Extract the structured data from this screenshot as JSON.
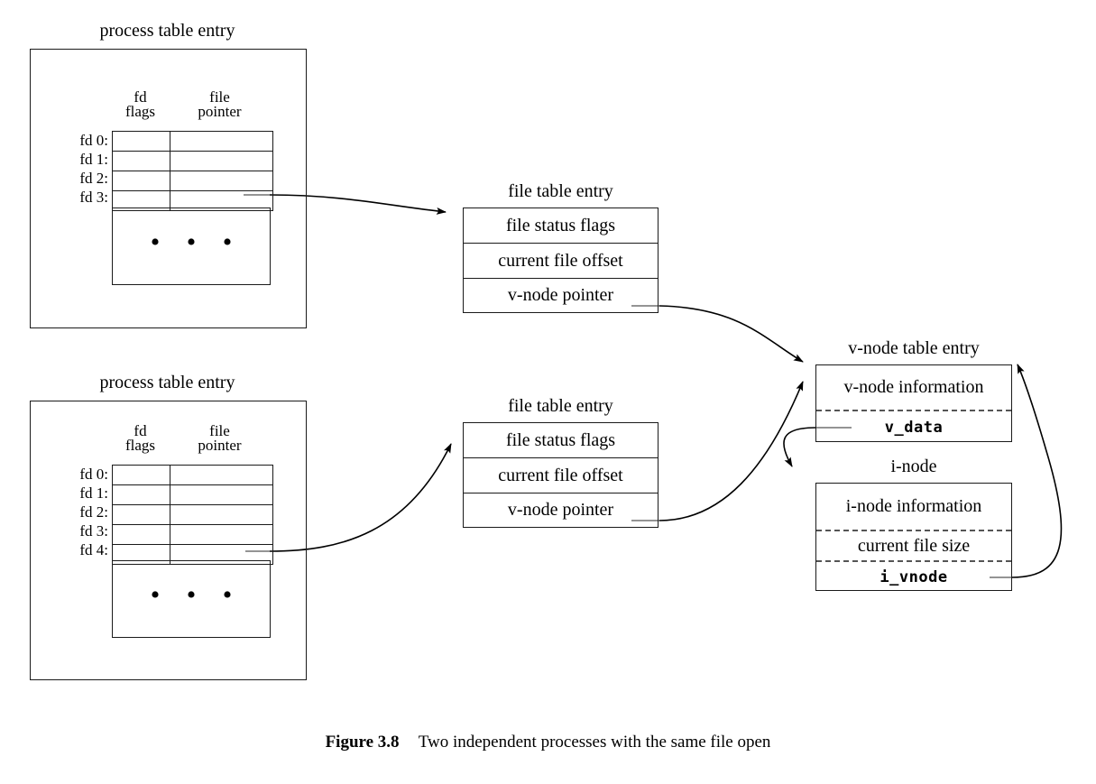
{
  "figure": {
    "number_label": "Figure 3.8",
    "caption": "Two independent processes with the same file open"
  },
  "column_headers": {
    "fd_flags_line1": "fd",
    "fd_flags_line2": "flags",
    "file_pointer_line1": "file",
    "file_pointer_line2": "pointer"
  },
  "process_tables": [
    {
      "title": "process table entry",
      "fd_rows": [
        "fd 0:",
        "fd 1:",
        "fd 2:",
        "fd 3:"
      ],
      "ellipsis": "•  •  •"
    },
    {
      "title": "process table entry",
      "fd_rows": [
        "fd 0:",
        "fd 1:",
        "fd 2:",
        "fd 3:",
        "fd 4:"
      ],
      "ellipsis": "•  •  •"
    }
  ],
  "file_tables": [
    {
      "title": "file table entry",
      "rows": [
        "file status flags",
        "current file offset",
        "v-node pointer"
      ]
    },
    {
      "title": "file table entry",
      "rows": [
        "file status flags",
        "current file offset",
        "v-node pointer"
      ]
    }
  ],
  "vnode_table": {
    "title": "v-node table entry",
    "rows": [
      {
        "text": "v-node information",
        "mono": false
      },
      {
        "text": "v_data",
        "mono": true
      }
    ]
  },
  "inode": {
    "title": "i-node",
    "rows": [
      {
        "text": "i-node information",
        "mono": false
      },
      {
        "text": "current file size",
        "mono": false
      },
      {
        "text": "i_vnode",
        "mono": true
      }
    ]
  },
  "colors": {
    "line": "#1a1a1a",
    "dashed": "#555555",
    "background": "#ffffff"
  }
}
